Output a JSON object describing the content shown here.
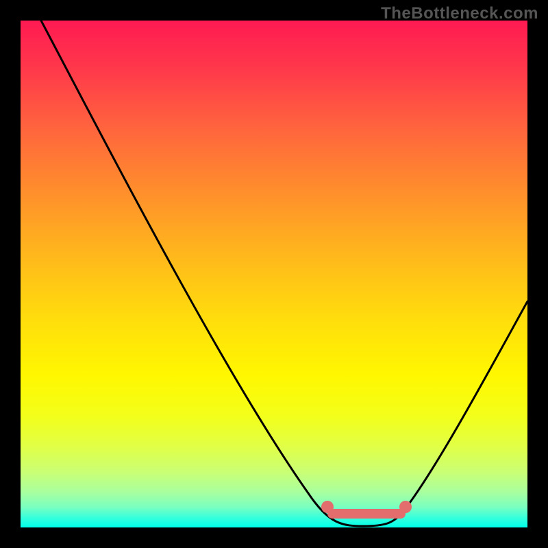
{
  "watermark": "TheBottleneck.com",
  "chart_data": {
    "type": "line",
    "title": "",
    "xlabel": "",
    "ylabel": "",
    "xlim": [
      0,
      100
    ],
    "ylim": [
      0,
      100
    ],
    "x": [
      0,
      5,
      10,
      15,
      20,
      25,
      30,
      35,
      40,
      45,
      50,
      55,
      60,
      63,
      66,
      70,
      74,
      78,
      82,
      86,
      90,
      95,
      100
    ],
    "values": [
      100,
      93,
      86,
      79,
      72,
      65,
      58,
      51,
      44,
      36,
      28,
      19,
      10,
      5,
      2,
      0,
      0,
      2,
      8,
      16,
      24,
      34,
      44
    ],
    "optimal_zone": {
      "x_start": 63,
      "x_end": 77,
      "y": 5
    },
    "gradient_colors": {
      "top": "#ff1a52",
      "mid": "#ffe00b",
      "bottom": "#00ffe9"
    },
    "annotations": []
  }
}
